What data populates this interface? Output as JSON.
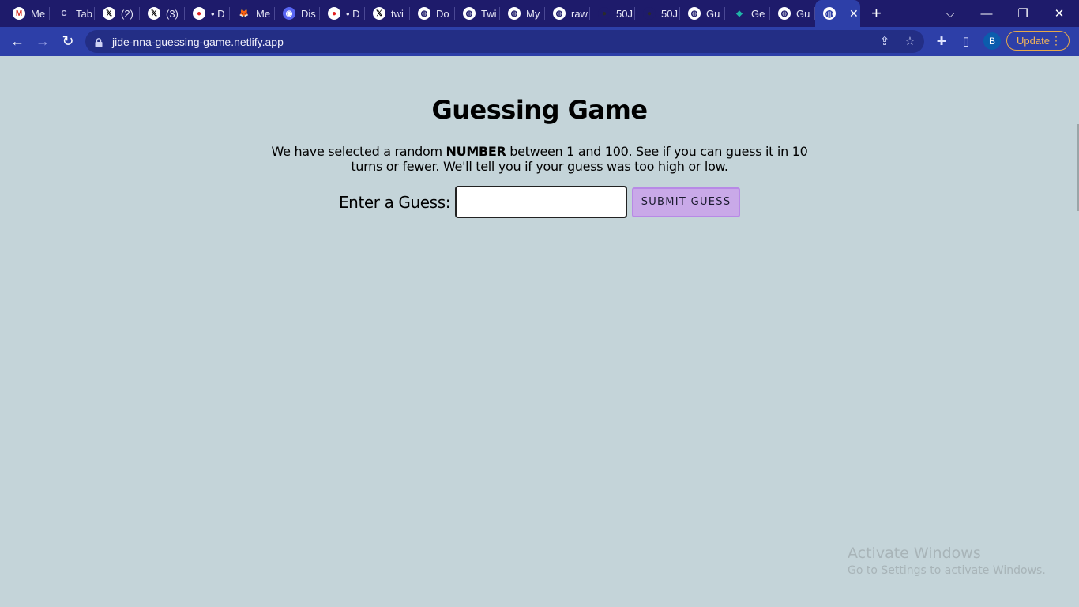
{
  "browser": {
    "tabs": [
      {
        "label": "Me",
        "icon": "gmail-icon",
        "favicon_text": "M",
        "favicon_bg": "#ffffff",
        "favicon_fg": "#d93025"
      },
      {
        "label": "Tab",
        "icon": "tab-loading-icon",
        "favicon_text": "C",
        "favicon_bg": "transparent",
        "favicon_fg": "#c8c8e8"
      },
      {
        "label": "(2)",
        "icon": "x-logo-icon",
        "favicon_text": "𝕏",
        "favicon_bg": "#ffffff",
        "favicon_fg": "#000000"
      },
      {
        "label": "(3)",
        "icon": "x-logo-icon",
        "favicon_text": "𝕏",
        "favicon_bg": "#ffffff",
        "favicon_fg": "#000000"
      },
      {
        "label": "• D",
        "icon": "red-notification-icon",
        "favicon_text": "●",
        "favicon_bg": "#ffffff",
        "favicon_fg": "#e02020"
      },
      {
        "label": "Me",
        "icon": "metamask-fox-icon",
        "favicon_text": "🦊",
        "favicon_bg": "transparent",
        "favicon_fg": "#f6851b"
      },
      {
        "label": "Dis",
        "icon": "discord-icon",
        "favicon_text": "◉",
        "favicon_bg": "#5865f2",
        "favicon_fg": "#ffffff"
      },
      {
        "label": "• D",
        "icon": "red-notification-icon",
        "favicon_text": "●",
        "favicon_bg": "#ffffff",
        "favicon_fg": "#e02020"
      },
      {
        "label": "twi",
        "icon": "x-logo-icon",
        "favicon_text": "𝕏",
        "favicon_bg": "#ffffff",
        "favicon_fg": "#000000"
      },
      {
        "label": "Do",
        "icon": "globe-icon",
        "favicon_text": "◍",
        "favicon_bg": "#ffffff",
        "favicon_fg": "#1e1b6b"
      },
      {
        "label": "Twi",
        "icon": "globe-icon",
        "favicon_text": "◍",
        "favicon_bg": "#ffffff",
        "favicon_fg": "#1e1b6b"
      },
      {
        "label": "My",
        "icon": "globe-icon",
        "favicon_text": "◍",
        "favicon_bg": "#ffffff",
        "favicon_fg": "#1e1b6b"
      },
      {
        "label": "raw",
        "icon": "globe-icon",
        "favicon_text": "◍",
        "favicon_bg": "#ffffff",
        "favicon_fg": "#1e1b6b"
      },
      {
        "label": "50J",
        "icon": "github-icon",
        "favicon_text": "●",
        "favicon_bg": "#1e1b6b",
        "favicon_fg": "#2b2b2b"
      },
      {
        "label": "50J",
        "icon": "github-icon",
        "favicon_text": "●",
        "favicon_bg": "#1e1b6b",
        "favicon_fg": "#2b2b2b"
      },
      {
        "label": "Gu",
        "icon": "globe-icon",
        "favicon_text": "◍",
        "favicon_bg": "#ffffff",
        "favicon_fg": "#1e1b6b"
      },
      {
        "label": "Ge",
        "icon": "teal-diamond-icon",
        "favicon_text": "◆",
        "favicon_bg": "transparent",
        "favicon_fg": "#1fb5a8"
      },
      {
        "label": "Gu",
        "icon": "globe-icon",
        "favicon_text": "◍",
        "favicon_bg": "#ffffff",
        "favicon_fg": "#1e1b6b"
      }
    ],
    "active_tab": {
      "icon": "globe-icon",
      "favicon_text": "◍",
      "close_glyph": "✕"
    },
    "new_tab_glyph": "+",
    "window_controls": {
      "dropdown": "⌵",
      "minimize": "—",
      "restore": "❐",
      "close": "✕"
    },
    "nav": {
      "back": "←",
      "forward": "→",
      "reload": "↻"
    },
    "url": "jide-nna-guessing-game.netlify.app",
    "toolbar_icons": {
      "share": "⇪",
      "star": "☆",
      "extensions": "✚",
      "sidepanel": "▯"
    },
    "profile_initial": "B",
    "update_label": "Update",
    "update_menu": "⋮"
  },
  "page": {
    "title": "Guessing Game",
    "intro_before": "We have selected a random ",
    "intro_bold": "NUMBER",
    "intro_after": " between 1 and 100. See if you can guess it in 10 turns or fewer. We'll tell you if your guess was too high or low.",
    "guess_label": "Enter a Guess:",
    "guess_value": "",
    "submit_label": "SUBMIT GUESS"
  },
  "watermark": {
    "line1": "Activate Windows",
    "line2": "Go to Settings to activate Windows."
  },
  "colors": {
    "tabstrip": "#1e1b6b",
    "toolbar": "#2d3fa8",
    "page_bg": "#c4d4d9",
    "submit_bg": "#c9a9e8",
    "update_accent": "#f3b65a"
  }
}
